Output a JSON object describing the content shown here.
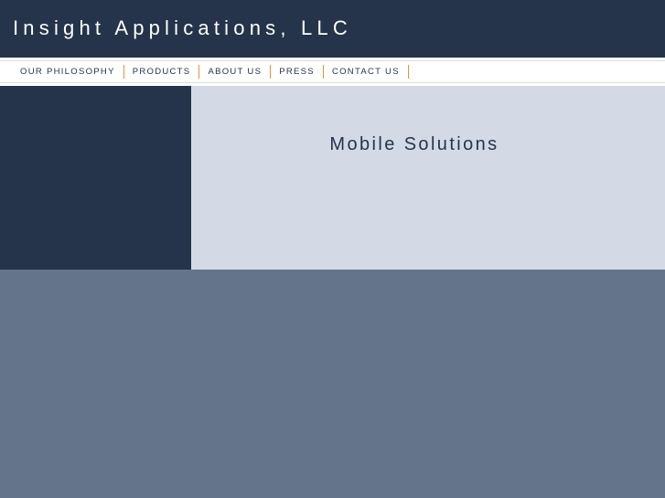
{
  "header": {
    "title": "Insight Applications, LLC"
  },
  "nav": {
    "items": [
      {
        "label": "OUR PHILOSOPHY"
      },
      {
        "label": "PRODUCTS"
      },
      {
        "label": "ABOUT US"
      },
      {
        "label": "PRESS"
      },
      {
        "label": "CONTACT US"
      }
    ]
  },
  "main": {
    "title": "Mobile Solutions"
  },
  "colors": {
    "header_bg": "#25344a",
    "nav_divider": "#e8913a",
    "content_bg": "#d3dae5",
    "footer_bg": "#64748a"
  }
}
